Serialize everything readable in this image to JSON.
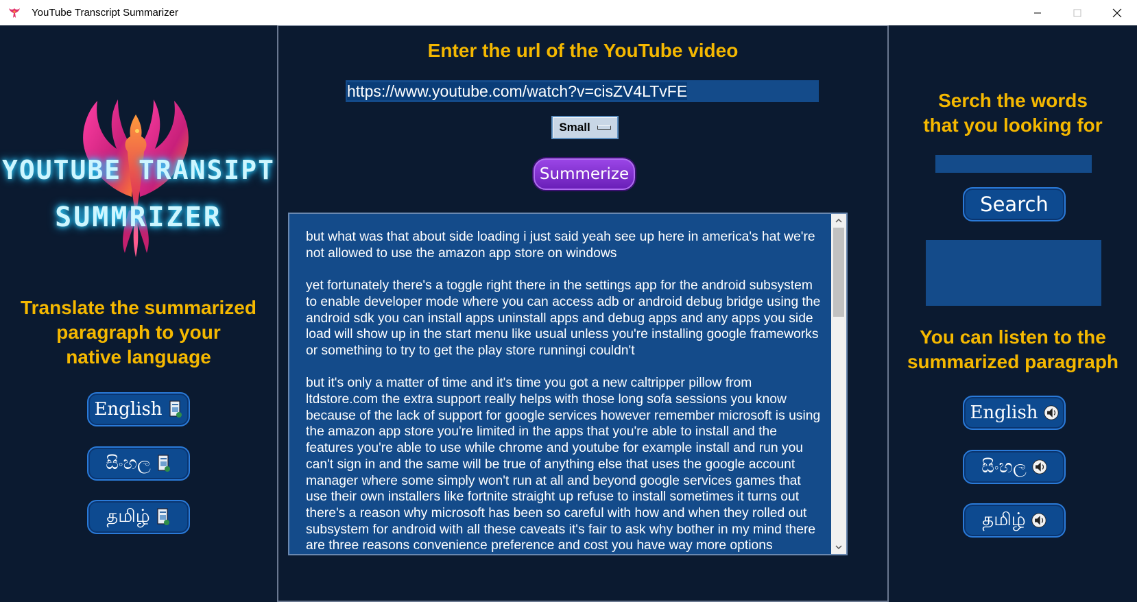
{
  "window": {
    "title": "YouTube Transcript Summarizer",
    "minimize_icon": "minimize-icon",
    "maximize_icon": "maximize-icon",
    "close_icon": "close-icon"
  },
  "logo": {
    "line1": "YOUTUBE TRANSIPT",
    "line2": "SUMMRIZER",
    "icon": "phoenix-icon"
  },
  "left": {
    "heading_lines": [
      "Translate the summarized",
      "paragraph to your",
      "native language"
    ],
    "buttons": [
      {
        "label": "English",
        "icon": "translate-document-icon"
      },
      {
        "label": "සිංහල",
        "icon": "translate-document-icon"
      },
      {
        "label": "தமிழ்",
        "icon": "translate-document-icon"
      }
    ]
  },
  "center": {
    "heading": "Enter the url of the YouTube video",
    "url_value": "https://www.youtube.com/watch?v=cisZV4LTvFE",
    "size_option": "Small",
    "summarize_label": "Summerize",
    "paragraphs": [
      "but what was that about side loading i just said yeah see up here in america's hat we're not allowed to use the amazon app store on windows",
      "yet fortunately there's a toggle right there in the settings app for the android subsystem to enable developer mode where you can access adb or android debug bridge using the android sdk you can install apps uninstall apps and debug apps and any apps you side load will show up in the start menu like usual unless you're installing google frameworks or something to try to get the play store runningi couldn't",
      "but it's only a matter of time and it's time you got a new caltripper pillow from ltdstore.com the extra support really helps with those long sofa sessions you know because of the lack of support for google services however remember microsoft is using the amazon app store you're limited in the apps that you're able to install and the features you're able to use while chrome and youtube for example install and run you can't sign in and the same will be true of anything else that uses the google account manager where some simply won't run at all and beyond google services games that use their own installers like fortnite straight up refuse to install sometimes it turns out there's a reason why microsoft has been so careful with how and when they rolled out subsystem for android with all these caveats it's fair to ask why bother in my mind there are three reasons convenience preference and cost you have way more options"
    ]
  },
  "right": {
    "search_heading_lines": [
      "Serch the words",
      "that you looking for"
    ],
    "search_value": "",
    "search_label": "Search",
    "listen_heading_lines": [
      "You can listen to the",
      "summarized paragraph"
    ],
    "buttons": [
      {
        "label": "English",
        "icon": "speaker-icon"
      },
      {
        "label": "සිංහල",
        "icon": "speaker-icon"
      },
      {
        "label": "தமிழ்",
        "icon": "speaker-icon"
      }
    ]
  },
  "colors": {
    "background": "#0b1a30",
    "heading": "#f5b800",
    "field": "#144b8a",
    "button": "#0d4a90",
    "summarize_button": "#7b2fd0"
  }
}
